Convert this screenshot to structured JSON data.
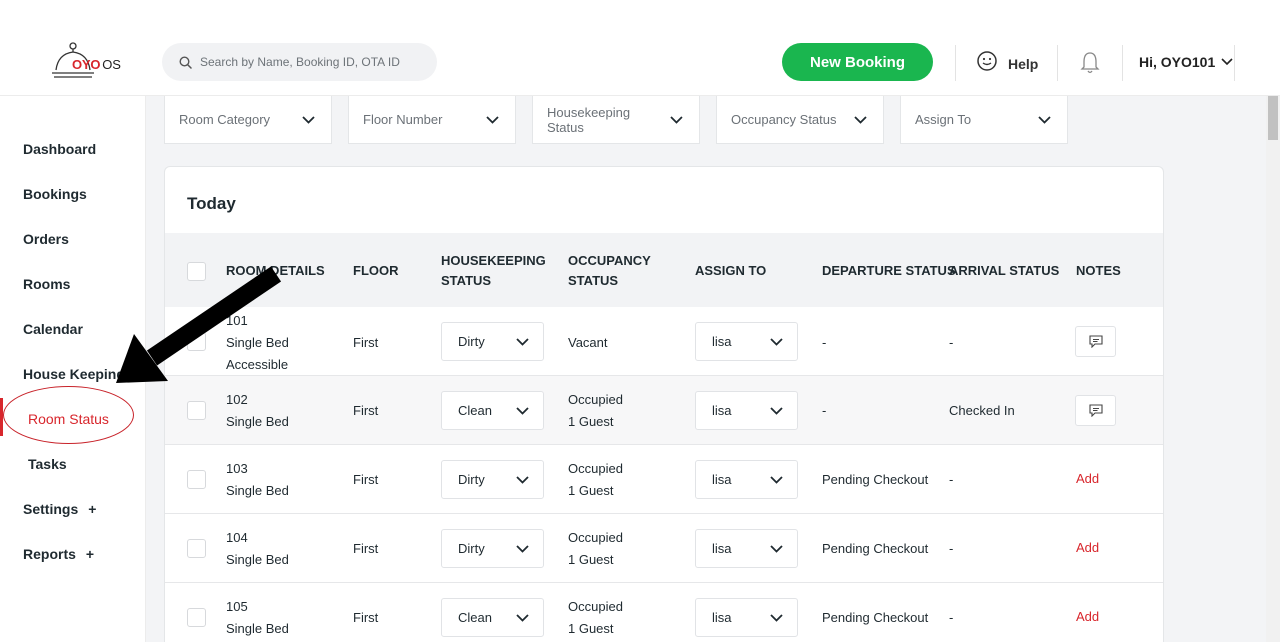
{
  "brand": {
    "logo_primary": "OYO",
    "logo_secondary": "OS",
    "accent": "#d8262c",
    "green": "#1ab64f"
  },
  "search": {
    "placeholder": "Search by Name, Booking ID, OTA ID"
  },
  "header": {
    "new_booking_label": "New Booking",
    "help_label": "Help",
    "user_label": "Hi, OYO101"
  },
  "sidebar": {
    "items": [
      {
        "label": "Dashboard",
        "expandable": false
      },
      {
        "label": "Bookings",
        "expandable": false
      },
      {
        "label": "Orders",
        "expandable": false
      },
      {
        "label": "Rooms",
        "expandable": false
      },
      {
        "label": "Calendar",
        "expandable": false
      },
      {
        "label": "House Keeping",
        "expandable": false
      },
      {
        "label": "Room Status",
        "expandable": false,
        "active": true
      },
      {
        "label": "Tasks",
        "expandable": false
      },
      {
        "label": "Settings",
        "expandable": true
      },
      {
        "label": "Reports",
        "expandable": true
      }
    ],
    "plus_symbol": "+"
  },
  "filters": [
    "Room Category",
    "Floor Number",
    "Housekeeping Status",
    "Occupancy Status",
    "Assign To"
  ],
  "card": {
    "title": "Today"
  },
  "table": {
    "headers": {
      "room_details": "ROOM DETAILS",
      "floor": "FLOOR",
      "housekeeping_1": "HOUSEKEEPING",
      "housekeeping_2": "STATUS",
      "occupancy_1": "OCCUPANCY",
      "occupancy_2": "STATUS",
      "assign_to": "ASSIGN TO",
      "departure_status": "DEPARTURE STATUS",
      "arrival_status": "ARRIVAL STATUS",
      "notes": "NOTES"
    },
    "rows": [
      {
        "room": "101",
        "type": "Single Bed",
        "extra": "Accessible",
        "floor": "First",
        "housekeeping": "Dirty",
        "occupancy": "Vacant",
        "guests": "",
        "assign": "lisa",
        "departure": "-",
        "arrival": "-",
        "note": "icon"
      },
      {
        "room": "102",
        "type": "Single Bed",
        "extra": "",
        "floor": "First",
        "housekeeping": "Clean",
        "occupancy": "Occupied",
        "guests": "1 Guest",
        "assign": "lisa",
        "departure": "-",
        "arrival": "Checked In",
        "note": "icon"
      },
      {
        "room": "103",
        "type": "Single Bed",
        "extra": "",
        "floor": "First",
        "housekeeping": "Dirty",
        "occupancy": "Occupied",
        "guests": "1 Guest",
        "assign": "lisa",
        "departure": "Pending Checkout",
        "arrival": "-",
        "note": "Add"
      },
      {
        "room": "104",
        "type": "Single Bed",
        "extra": "",
        "floor": "First",
        "housekeeping": "Dirty",
        "occupancy": "Occupied",
        "guests": "1 Guest",
        "assign": "lisa",
        "departure": "Pending Checkout",
        "arrival": "-",
        "note": "Add"
      },
      {
        "room": "105",
        "type": "Single Bed",
        "extra": "",
        "floor": "First",
        "housekeeping": "Clean",
        "occupancy": "Occupied",
        "guests": "1 Guest",
        "assign": "lisa",
        "departure": "Pending Checkout",
        "arrival": "-",
        "note": "Add"
      }
    ]
  }
}
